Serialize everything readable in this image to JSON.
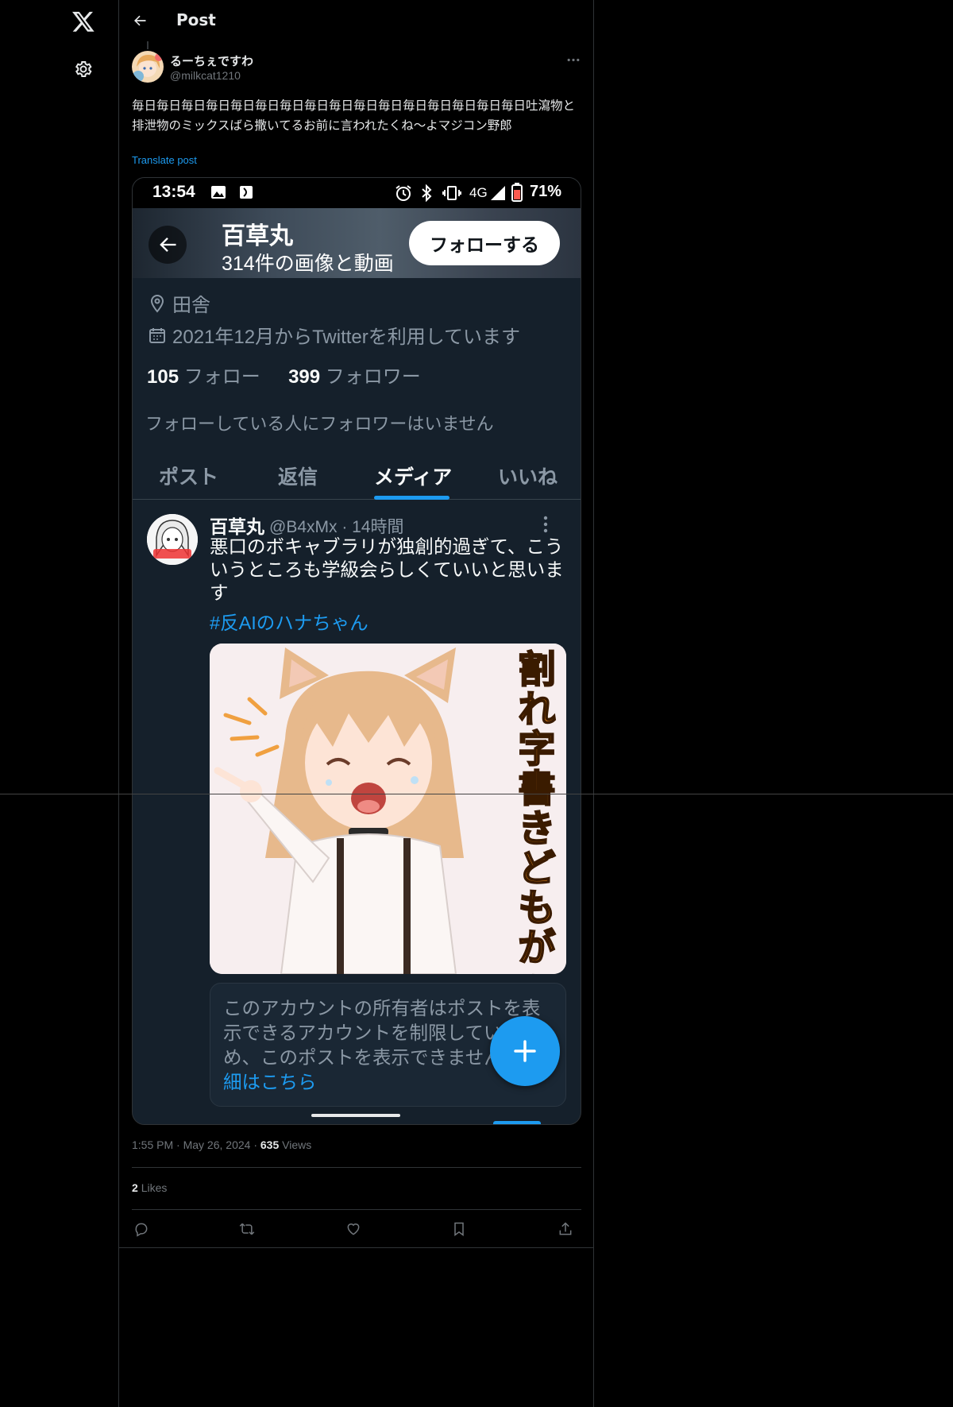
{
  "header": {
    "title": "Post"
  },
  "post": {
    "author_name": "るーちぇですわ",
    "author_handle": "@milkcat1210",
    "text": "毎日毎日毎日毎日毎日毎日毎日毎日毎日毎日毎日毎日毎日毎日毎日毎日吐瀉物と排泄物のミックスばら撒いてるお前に言われたくね〜よマジコン野郎",
    "translate_label": "Translate post",
    "time": "1:55 PM",
    "date": "May 26, 2024",
    "views_count": "635",
    "views_label": "Views",
    "likes_count": "2",
    "likes_label": "Likes"
  },
  "embedded_screenshot": {
    "status_time": "13:54",
    "network": "4G",
    "battery": "71%",
    "profile_name": "百草丸",
    "media_count": "314件の画像と動画",
    "follow_button": "フォローする",
    "location": "田舎",
    "joined": "2021年12月からTwitterを利用しています",
    "following_count": "105",
    "following_label": "フォロー",
    "followers_count": "399",
    "followers_label": "フォロワー",
    "no_mutual_followers": "フォローしている人にフォロワーはいません",
    "tabs": [
      "ポスト",
      "返信",
      "メディア",
      "いいね"
    ],
    "active_tab_index": 2,
    "inner_post": {
      "name": "百草丸",
      "handle_time": "@B4xMx · 14時間",
      "text": "悪口のボキャブラリが独創的過ぎて、こういうところも学級会らしくていいと思います",
      "hashtag": "#反AIのハナちゃん",
      "image_caption": "割れ字書きどもがぁ"
    },
    "restricted_notice": "このアカウントの所有者はポストを表示できるアカウントを制限しているため、このポストを表示できません。",
    "restricted_link": "詳細はこちら"
  },
  "colors": {
    "accent": "#1d9bf0",
    "background": "#000000",
    "inner_bg": "#15202b",
    "muted": "#71767b"
  },
  "icons": [
    "x-logo-icon",
    "gear-icon",
    "back-arrow-icon",
    "more-icon",
    "reply-icon",
    "repost-icon",
    "like-icon",
    "bookmark-icon",
    "share-icon"
  ]
}
